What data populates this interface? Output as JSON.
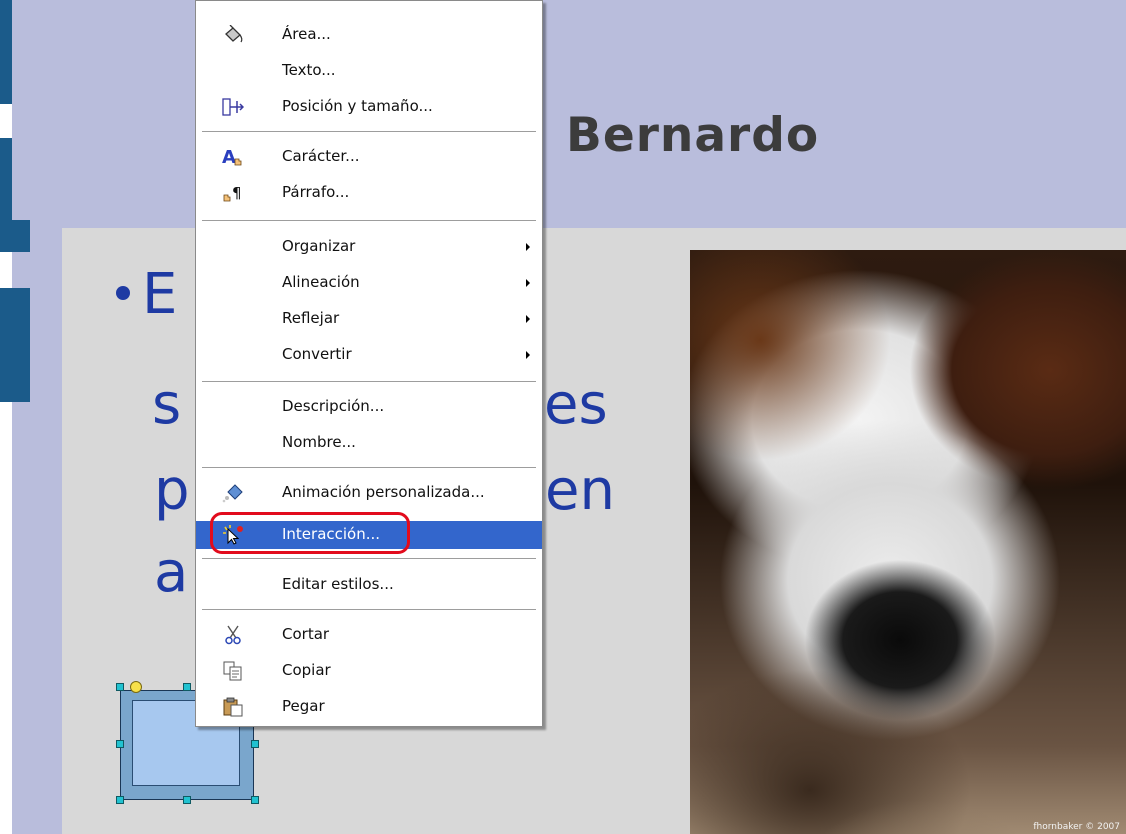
{
  "slide": {
    "title_fragment": "Bernardo",
    "bullet_fragments": [
      "E",
      "s",
      "es",
      "p",
      "en",
      "a"
    ],
    "photo_credit": "fhornbaker © 2007"
  },
  "context_menu": {
    "items": [
      {
        "label": "Área...",
        "icon": "fill-bucket-icon"
      },
      {
        "label": "Texto..."
      },
      {
        "label": "Posición y tamaño...",
        "icon": "position-size-icon"
      },
      {
        "label": "Carácter...",
        "icon": "character-icon"
      },
      {
        "label": "Párrafo...",
        "icon": "paragraph-icon"
      },
      {
        "label": "Organizar",
        "submenu": true
      },
      {
        "label": "Alineación",
        "submenu": true
      },
      {
        "label": "Reflejar",
        "submenu": true
      },
      {
        "label": "Convertir",
        "submenu": true
      },
      {
        "label": "Descripción..."
      },
      {
        "label": "Nombre..."
      },
      {
        "label": "Animación personalizada...",
        "icon": "custom-animation-icon"
      },
      {
        "label": "Interacción...",
        "icon": "interaction-icon",
        "selected": true
      },
      {
        "label": "Editar estilos..."
      },
      {
        "label": "Cortar",
        "icon": "scissors-icon"
      },
      {
        "label": "Copiar",
        "icon": "copy-icon"
      },
      {
        "label": "Pegar",
        "icon": "paste-icon"
      }
    ]
  },
  "colors": {
    "title_band": "#b9bddc",
    "content_panel": "#d8d8d8",
    "bullet_text": "#1e3aa3",
    "menu_highlight": "#3366cc",
    "annotation_ring": "#e20b1c"
  }
}
